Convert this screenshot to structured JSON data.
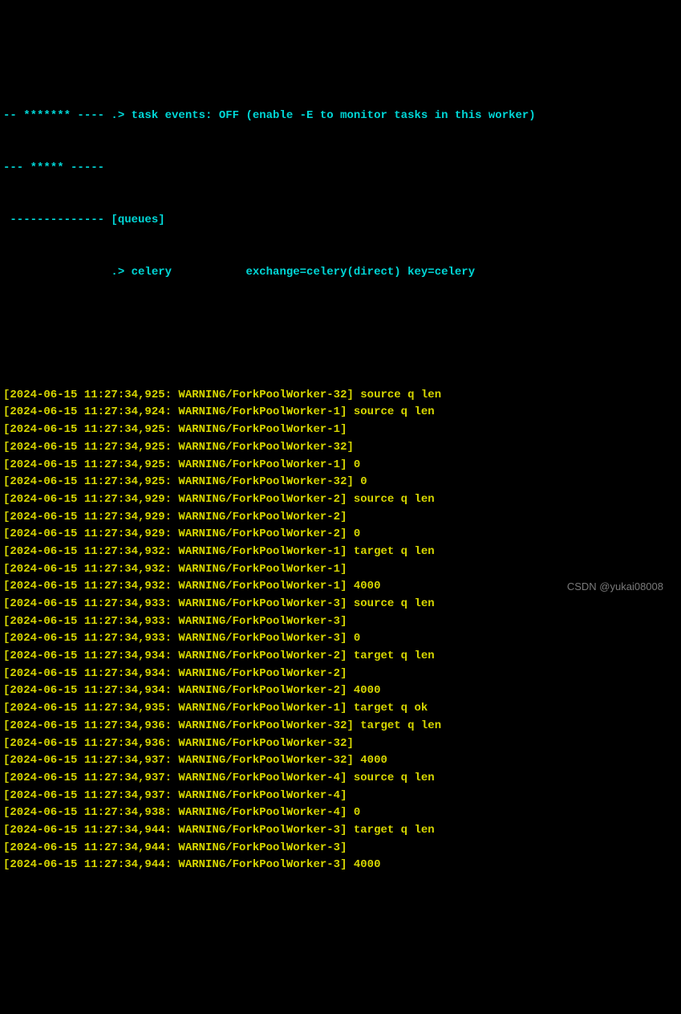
{
  "header": {
    "line1_prefix": "-- ******* ---- ",
    "line1_task": ".> task events: OFF (enable -E to monitor tasks in this worker)",
    "line2": "--- ***** -----",
    "line3_prefix": " -------------- ",
    "line3_queues": "[queues]",
    "line4_prefix": "                ",
    "line4_content": ".> celery           exchange=celery(direct) key=celery"
  },
  "logs": [
    {
      "ts": "2024-06-15 11:27:34,925",
      "level": "WARNING",
      "worker": "ForkPoolWorker-32",
      "msg": " source q len"
    },
    {
      "ts": "2024-06-15 11:27:34,924",
      "level": "WARNING",
      "worker": "ForkPoolWorker-1",
      "msg": " source q len"
    },
    {
      "ts": "2024-06-15 11:27:34,925",
      "level": "WARNING",
      "worker": "ForkPoolWorker-1",
      "msg": ""
    },
    {
      "ts": "2024-06-15 11:27:34,925",
      "level": "WARNING",
      "worker": "ForkPoolWorker-32",
      "msg": ""
    },
    {
      "ts": "2024-06-15 11:27:34,925",
      "level": "WARNING",
      "worker": "ForkPoolWorker-1",
      "msg": " 0"
    },
    {
      "ts": "2024-06-15 11:27:34,925",
      "level": "WARNING",
      "worker": "ForkPoolWorker-32",
      "msg": " 0"
    },
    {
      "ts": "2024-06-15 11:27:34,929",
      "level": "WARNING",
      "worker": "ForkPoolWorker-2",
      "msg": " source q len"
    },
    {
      "ts": "2024-06-15 11:27:34,929",
      "level": "WARNING",
      "worker": "ForkPoolWorker-2",
      "msg": ""
    },
    {
      "ts": "2024-06-15 11:27:34,929",
      "level": "WARNING",
      "worker": "ForkPoolWorker-2",
      "msg": " 0"
    },
    {
      "ts": "2024-06-15 11:27:34,932",
      "level": "WARNING",
      "worker": "ForkPoolWorker-1",
      "msg": " target q len"
    },
    {
      "ts": "2024-06-15 11:27:34,932",
      "level": "WARNING",
      "worker": "ForkPoolWorker-1",
      "msg": ""
    },
    {
      "ts": "2024-06-15 11:27:34,932",
      "level": "WARNING",
      "worker": "ForkPoolWorker-1",
      "msg": " 4000"
    },
    {
      "ts": "2024-06-15 11:27:34,933",
      "level": "WARNING",
      "worker": "ForkPoolWorker-3",
      "msg": " source q len"
    },
    {
      "ts": "2024-06-15 11:27:34,933",
      "level": "WARNING",
      "worker": "ForkPoolWorker-3",
      "msg": ""
    },
    {
      "ts": "2024-06-15 11:27:34,933",
      "level": "WARNING",
      "worker": "ForkPoolWorker-3",
      "msg": " 0"
    },
    {
      "ts": "2024-06-15 11:27:34,934",
      "level": "WARNING",
      "worker": "ForkPoolWorker-2",
      "msg": " target q len"
    },
    {
      "ts": "2024-06-15 11:27:34,934",
      "level": "WARNING",
      "worker": "ForkPoolWorker-2",
      "msg": ""
    },
    {
      "ts": "2024-06-15 11:27:34,934",
      "level": "WARNING",
      "worker": "ForkPoolWorker-2",
      "msg": " 4000"
    },
    {
      "ts": "2024-06-15 11:27:34,935",
      "level": "WARNING",
      "worker": "ForkPoolWorker-1",
      "msg": " target q ok"
    },
    {
      "ts": "2024-06-15 11:27:34,936",
      "level": "WARNING",
      "worker": "ForkPoolWorker-32",
      "msg": " target q len"
    },
    {
      "ts": "2024-06-15 11:27:34,936",
      "level": "WARNING",
      "worker": "ForkPoolWorker-32",
      "msg": ""
    },
    {
      "ts": "2024-06-15 11:27:34,937",
      "level": "WARNING",
      "worker": "ForkPoolWorker-32",
      "msg": " 4000"
    },
    {
      "ts": "2024-06-15 11:27:34,937",
      "level": "WARNING",
      "worker": "ForkPoolWorker-4",
      "msg": " source q len"
    },
    {
      "ts": "2024-06-15 11:27:34,937",
      "level": "WARNING",
      "worker": "ForkPoolWorker-4",
      "msg": ""
    },
    {
      "ts": "2024-06-15 11:27:34,938",
      "level": "WARNING",
      "worker": "ForkPoolWorker-4",
      "msg": " 0"
    },
    {
      "ts": "2024-06-15 11:27:34,944",
      "level": "WARNING",
      "worker": "ForkPoolWorker-3",
      "msg": " target q len"
    },
    {
      "ts": "2024-06-15 11:27:34,944",
      "level": "WARNING",
      "worker": "ForkPoolWorker-3",
      "msg": ""
    },
    {
      "ts": "2024-06-15 11:27:34,944",
      "level": "WARNING",
      "worker": "ForkPoolWorker-3",
      "msg": " 4000"
    }
  ],
  "watermark": "CSDN @yukai08008"
}
